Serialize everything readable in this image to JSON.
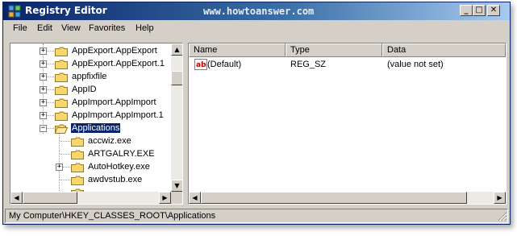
{
  "window": {
    "title": "Registry Editor",
    "watermark": "www.howtoanswer.com",
    "controls": {
      "minimize": "_",
      "maximize": "□",
      "close": "✕"
    }
  },
  "menu": [
    "File",
    "Edit",
    "View",
    "Favorites",
    "Help"
  ],
  "tree": {
    "items": [
      {
        "label": "AppExport.AppExport",
        "expander": "+",
        "selected": false
      },
      {
        "label": "AppExport.AppExport.1",
        "expander": "+",
        "selected": false
      },
      {
        "label": "appfixfile",
        "expander": "+",
        "selected": false
      },
      {
        "label": "AppID",
        "expander": "+",
        "selected": false
      },
      {
        "label": "AppImport.AppImport",
        "expander": "+",
        "selected": false
      },
      {
        "label": "AppImport.AppImport.1",
        "expander": "+",
        "selected": false
      },
      {
        "label": "Applications",
        "expander": "−",
        "selected": true
      },
      {
        "label": "accwiz.exe",
        "expander": "",
        "selected": false
      },
      {
        "label": "ARTGALRY.EXE",
        "expander": "",
        "selected": false
      },
      {
        "label": "AutoHotkey.exe",
        "expander": "+",
        "selected": false
      },
      {
        "label": "awdvstub.exe",
        "expander": "",
        "selected": false
      }
    ],
    "scroll_arrows": {
      "up": "▲",
      "down": "▼",
      "left": "◀",
      "right": "▶"
    }
  },
  "list": {
    "columns": [
      "Name",
      "Type",
      "Data"
    ],
    "rows": [
      {
        "icon": "ab",
        "name": "(Default)",
        "type": "REG_SZ",
        "data": "(value not set)"
      }
    ],
    "scroll_arrows": {
      "left": "◀",
      "right": "▶"
    }
  },
  "status": {
    "path": "My Computer\\HKEY_CLASSES_ROOT\\Applications"
  },
  "colors": {
    "titlebar_start": "#0a246a",
    "titlebar_end": "#a6caf0",
    "selection": "#0a246a",
    "folder": "#f5d76e",
    "chrome": "#d4d0c8"
  }
}
